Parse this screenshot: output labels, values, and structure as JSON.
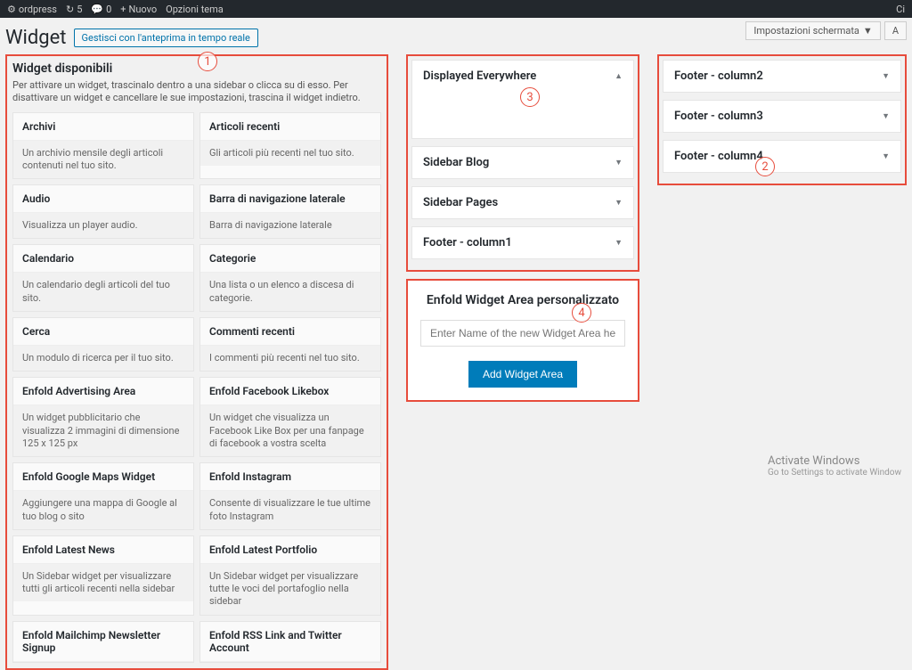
{
  "adminbar": {
    "wp": "ordpress",
    "refresh": "5",
    "comments": "0",
    "new": "Nuovo",
    "theme": "Opzioni tema",
    "right": "Ci"
  },
  "top": {
    "screen": "Impostazioni schermata",
    "help": "A"
  },
  "heading": {
    "title": "Widget",
    "preview": "Gestisci con l'anteprima in tempo reale"
  },
  "avail": {
    "title": "Widget disponibili",
    "desc": "Per attivare un widget, trascinalo dentro a una sidebar o clicca su di esso. Per disattivare un widget e cancellare le sue impostazioni, trascina il widget indietro."
  },
  "widgets": [
    {
      "t": "Archivi",
      "d": "Un archivio mensile degli articoli contenuti nel tuo sito."
    },
    {
      "t": "Articoli recenti",
      "d": "Gli articoli più recenti nel tuo sito."
    },
    {
      "t": "Audio",
      "d": "Visualizza un player audio."
    },
    {
      "t": "Barra di navigazione laterale",
      "d": "Barra di navigazione laterale"
    },
    {
      "t": "Calendario",
      "d": "Un calendario degli articoli del tuo sito."
    },
    {
      "t": "Categorie",
      "d": "Una lista o un elenco a discesa di categorie."
    },
    {
      "t": "Cerca",
      "d": "Un modulo di ricerca per il tuo sito."
    },
    {
      "t": "Commenti recenti",
      "d": "I commenti più recenti nel tuo sito."
    },
    {
      "t": "Enfold Advertising Area",
      "d": "Un widget pubblicitario che visualizza 2 immagini di dimensione 125 x 125 px"
    },
    {
      "t": "Enfold Facebook Likebox",
      "d": "Un widget che visualizza un Facebook Like Box per una fanpage di facebook a vostra scelta"
    },
    {
      "t": "Enfold Google Maps Widget",
      "d": "Aggiungere una mappa di Google al tuo blog o sito"
    },
    {
      "t": "Enfold Instagram",
      "d": "Consente di visualizzare le tue ultime foto Instagram"
    },
    {
      "t": "Enfold Latest News",
      "d": "Un Sidebar widget per visualizzare tutti gli articoli recenti nella sidebar"
    },
    {
      "t": "Enfold Latest Portfolio",
      "d": "Un Sidebar widget per visualizzare tutte le voci del portafoglio nella sidebar"
    },
    {
      "t": "Enfold Mailchimp Newsletter Signup",
      "d": ""
    },
    {
      "t": "Enfold RSS Link and Twitter Account",
      "d": ""
    }
  ],
  "areas_mid": [
    {
      "label": "Displayed Everywhere",
      "open": true
    },
    {
      "label": "Sidebar Blog",
      "open": false
    },
    {
      "label": "Sidebar Pages",
      "open": false
    },
    {
      "label": "Footer - column1",
      "open": false
    }
  ],
  "areas_far": [
    {
      "label": "Footer - column2"
    },
    {
      "label": "Footer - column3"
    },
    {
      "label": "Footer - column4"
    }
  ],
  "custom": {
    "title": "Enfold Widget Area personalizzato",
    "placeholder": "Enter Name of the new Widget Area here",
    "button": "Add Widget Area"
  },
  "watermark": {
    "l1": "Activate Windows",
    "l2": "Go to Settings to activate Window"
  },
  "marks": {
    "n1": "1",
    "n2": "2",
    "n3": "3",
    "n4": "4"
  }
}
